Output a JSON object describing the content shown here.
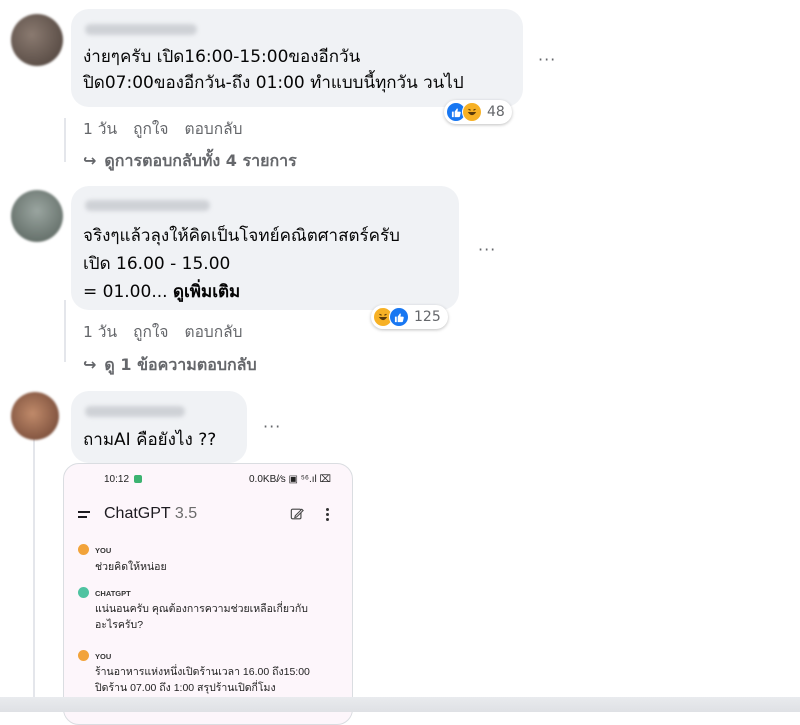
{
  "comments": [
    {
      "lines": [
        "ง่ายๆครับ เปิด16:00-15:00ของอีกวัน",
        "ปิด07:00ของอีกวัน-ถึง 01:00 ทำแบบนี้ทุกวัน วนไป"
      ],
      "reaction_count": "48",
      "time": "1 วัน",
      "like_label": "ถูกใจ",
      "reply_label": "ตอบกลับ",
      "view_replies": "ดูการตอบกลับทั้ง 4 รายการ",
      "more": "···"
    },
    {
      "lines": [
        "จริงๆแล้วลุงให้คิดเป็นโจทย์คณิตศาสตร์ครับ",
        "เปิด 16.00 - 15.00"
      ],
      "line3_prefix": "= 01.00... ",
      "see_more": "ดูเพิ่มเติม",
      "reaction_count": "125",
      "time": "1 วัน",
      "like_label": "ถูกใจ",
      "reply_label": "ตอบกลับ",
      "view_replies": "ดู 1 ข้อความตอบกลับ",
      "more": "···"
    },
    {
      "lines": [
        "ถามAI คือยังไง ??"
      ],
      "more": "···"
    }
  ],
  "phone": {
    "time": "10:12",
    "status_right": "0.0KB/⁄s ▣ ⁵⁶.ıl ⌧",
    "app_title": "ChatGPT",
    "app_version": "3.5",
    "messages": [
      {
        "sender": "YOU",
        "lines": [
          "ช่วยคิดให้หน่อย"
        ]
      },
      {
        "sender": "CHATGPT",
        "lines": [
          "แน่นอนครับ คุณต้องการความช่วยเหลือเกี่ยวกับ",
          "อะไรครับ?"
        ]
      },
      {
        "sender": "YOU",
        "lines": [
          "ร้านอาหารแห่งหนึ่งเปิดร้านเวลา 16.00 ถึง15:00",
          "ปิดร้าน 07.00 ถึง 1:00 สรุปร้านเปิดกี่โมง"
        ]
      }
    ]
  },
  "colors": {
    "bubble": "#f0f2f5",
    "meta_text": "#65676b",
    "like": "#1877f2",
    "haha": "#f7b125",
    "chatgpt_dot": "#4fc3a1",
    "you_dot": "#f2a33a"
  }
}
